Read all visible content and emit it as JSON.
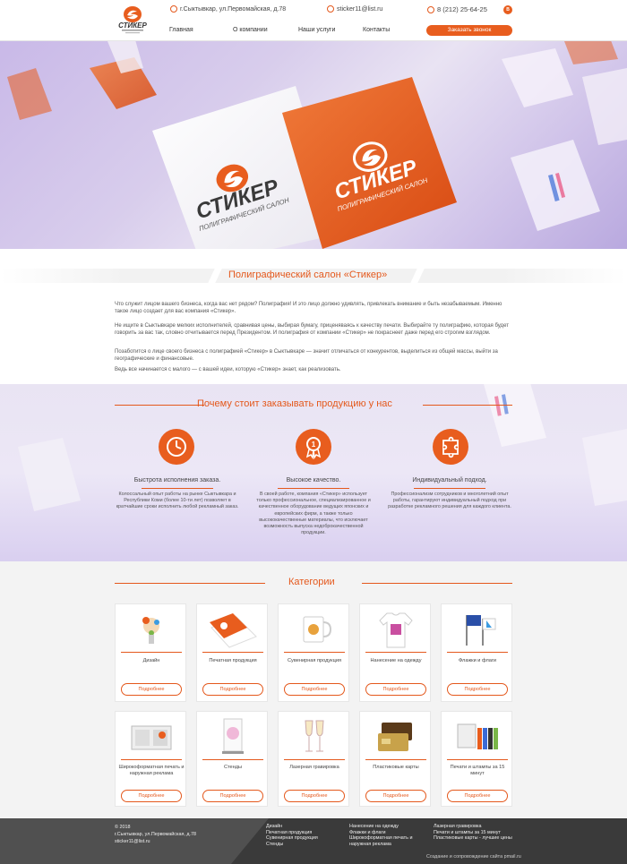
{
  "header": {
    "address": "г.Сыктывкар, ул.Первомайская, д.78",
    "email": "sticker11@list.ru",
    "phone": "8 (212) 25-64-25",
    "nav": [
      "Главная",
      "О компании",
      "Наши услуги",
      "Контакты"
    ],
    "call_button": "Заказать звонок",
    "logo_text": "СТИКЕР"
  },
  "hero": {
    "card_brand": "СТИКЕР",
    "card_sub": "ПОЛИГРАФИЧЕСКИЙ САЛОН"
  },
  "intro": {
    "title": "Полиграфический салон «Стикер»",
    "paragraphs": [
      "Что служит лицом вашего бизнеса, когда вас нет рядом? Полиграфия! И это лицо должно удивлять, привлекать внимание и быть незабываемым. Именно такое лицо создает для вас компания «Стикер».",
      "Не ищите в Сыктывкаре мелких исполнителей, сравнивая цены, выбирая бумагу, приценяваясь к качеству печати. Выбирайте ту полиграфию, которая будет говорить за вас так, словно отчитывается перед Президентом. И полиграфия от компании «Стикер» не покраснеет даже перед его строгим взглядом.",
      "Позаботится о лице своего бизнеса с полиграфией «Стикер» в Сыктывкаре — значит отличаться от конкурентов, выделиться из общей массы, выйти за географические и финансовые.",
      "Ведь все начинается с малого — с вашей идеи, которую «Стикер» знает, как реализовать."
    ]
  },
  "why": {
    "title": "Почему стоит заказывать продукцию у нас",
    "features": [
      {
        "icon": "clock-icon",
        "title": "Быстрота исполнения заказа.",
        "text": "Колоссальный опыт работы на рынке Сыктывкара и Республики Коми (более 10-ти лет) позволяет в кратчайшие сроки исполнить любой рекламный заказ."
      },
      {
        "icon": "medal-icon",
        "title": "Высокое качество.",
        "text": "В своей работе, компания «Стикер» использует только профессиональное, специализированное и качественное оборудование ведущих японских и европейских фирм, а также только высококачественные материалы, что исключает возможность выпуска недоброкачественной продукции."
      },
      {
        "icon": "puzzle-icon",
        "title": "Индивидуальный подход.",
        "text": "Профессионализм сотрудников и многолетний опыт работы, гарантируют индивидуальный подход при разработке рекламного решения для каждого клиента."
      }
    ]
  },
  "categories": {
    "title": "Категории",
    "more_label": "Подробнее",
    "items": [
      {
        "label": "Дизайн",
        "icon": "design-icon"
      },
      {
        "label": "Печатная продукция",
        "icon": "print-icon"
      },
      {
        "label": "Сувенирная продукция",
        "icon": "mug-icon"
      },
      {
        "label": "Нанесение на одежду",
        "icon": "tshirt-icon"
      },
      {
        "label": "Флажки и флаги",
        "icon": "flag-icon"
      },
      {
        "label": "Широкоформатная печать и наружная реклама",
        "icon": "billboard-icon"
      },
      {
        "label": "Стенды",
        "icon": "stand-icon"
      },
      {
        "label": "Лазерная гравировка",
        "icon": "glasses-icon"
      },
      {
        "label": "Пластиковые карты",
        "icon": "card-icon"
      },
      {
        "label": "Печати и штампы за 15 минут",
        "icon": "stamp-icon"
      }
    ]
  },
  "footer": {
    "copyright": "© 2018",
    "address": "г.Сыктывкар, ул.Первомайская, д.78",
    "email": "sticker11@list.ru",
    "col1": [
      "Дизайн",
      "Печатная продукция",
      "Сувенирная продукция",
      "Стенды"
    ],
    "col2": [
      "Нанесение на одежду",
      "Флажки и флаги",
      "Широкоформатная печать и наружная реклама"
    ],
    "col3": [
      "Лазерная гравировка",
      "Печати и штампы за 15 минут",
      "Пластиковые карты - лучшие цены"
    ],
    "credit": "Создание и сопровождение сайта pmail.ru"
  },
  "colors": {
    "accent": "#e85d1e",
    "footer": "#3a3a3a"
  }
}
